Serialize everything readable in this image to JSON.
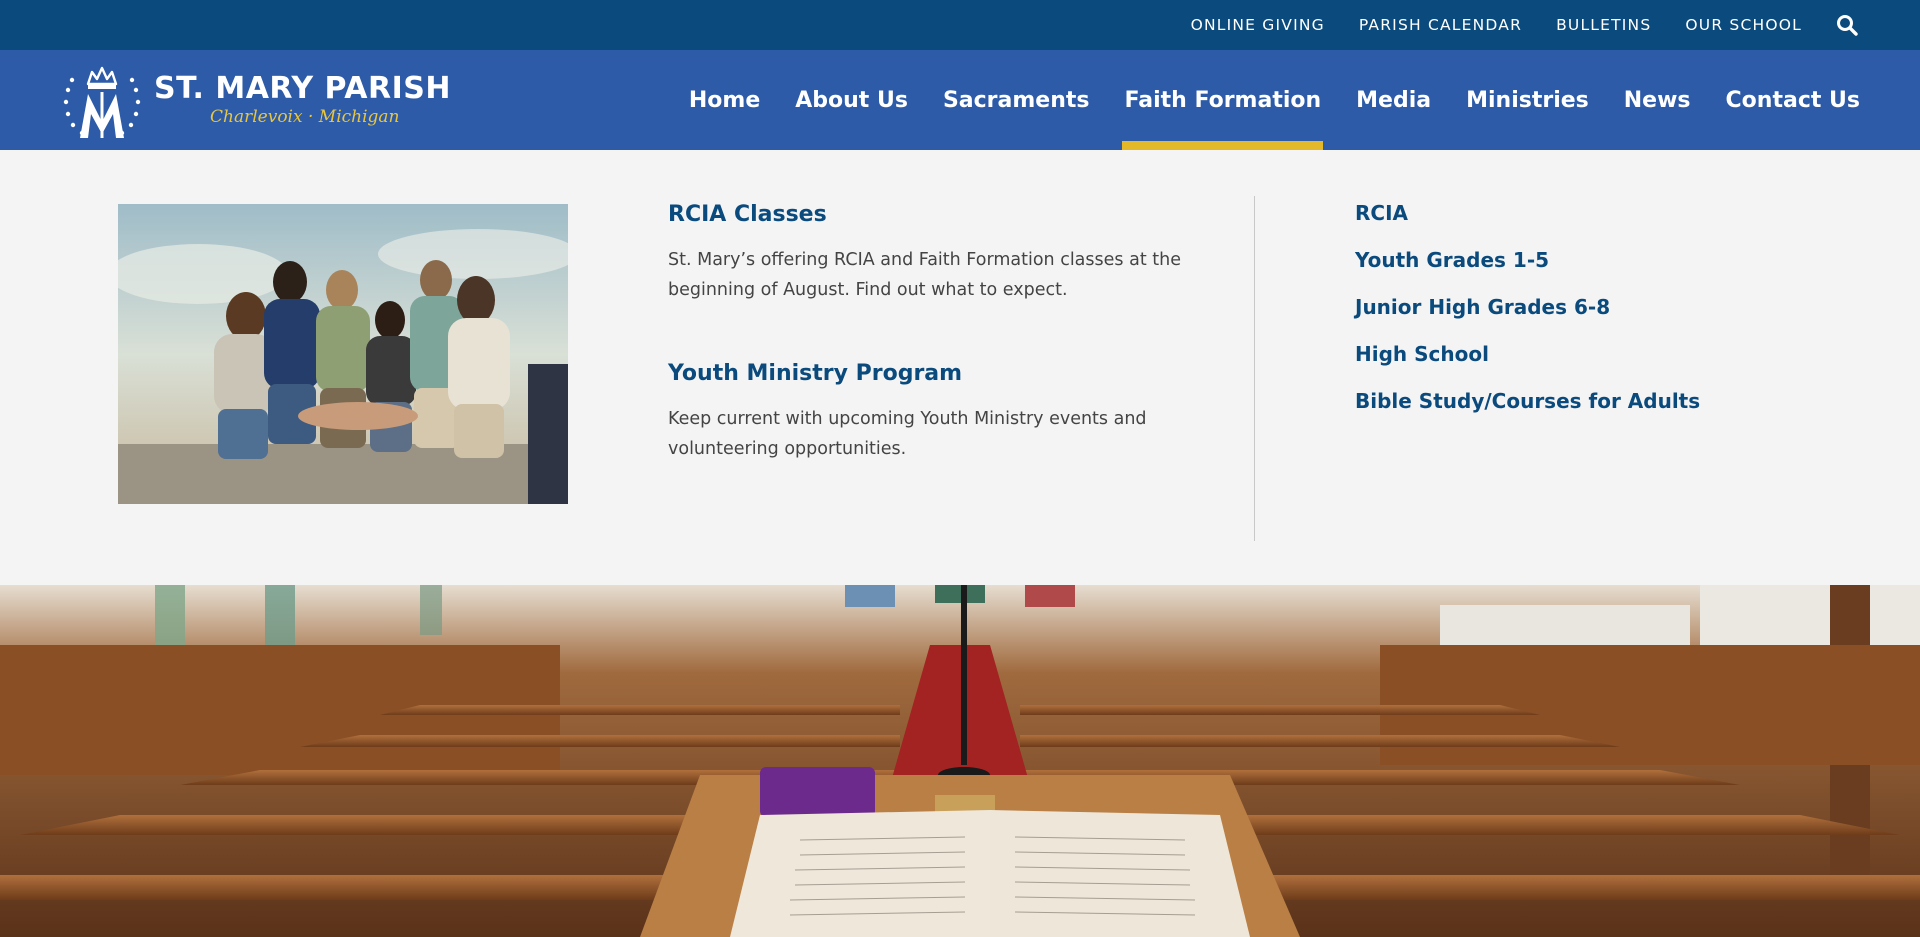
{
  "utility_nav": {
    "links": [
      "ONLINE GIVING",
      "PARISH CALENDAR",
      "BULLETINS",
      "OUR SCHOOL"
    ]
  },
  "brand": {
    "title": "ST. MARY PARISH",
    "subtitle": "Charlevoix · Michigan",
    "colors": {
      "navy": "#0a4a7d",
      "blue": "#2d5ba7",
      "gold": "#e3b92a"
    }
  },
  "main_nav": {
    "items": [
      "Home",
      "About Us",
      "Sacraments",
      "Faith Formation",
      "Media",
      "Ministries",
      "News",
      "Contact Us"
    ],
    "active": "Faith Formation"
  },
  "mega_menu": {
    "promos": [
      {
        "title": "RCIA Classes",
        "description": "St. Mary’s offering RCIA and Faith Formation classes at the beginning of August. Find out what to expect."
      },
      {
        "title": "Youth Ministry Program",
        "description": "Keep current with upcoming Youth Ministry events and volunteering opportunities."
      }
    ],
    "links": [
      "RCIA",
      "Youth Grades 1-5",
      "Junior High Grades 6-8",
      "High School",
      "Bible Study/Courses for Adults"
    ]
  }
}
